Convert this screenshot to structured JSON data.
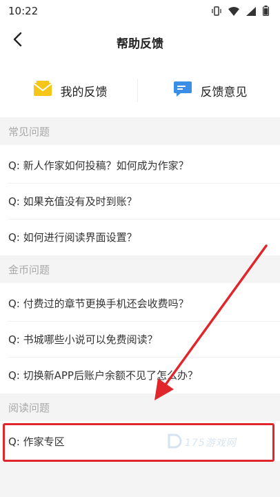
{
  "status_bar": {
    "time": "10:22"
  },
  "header": {
    "title": "帮助反馈"
  },
  "feedback": {
    "my_feedback_label": "我的反馈",
    "suggestion_label": "反馈意见"
  },
  "sections": [
    {
      "title": "常见问题",
      "questions": [
        "Q:  新人作家如何投稿？如何成为作家？",
        "Q:  如果充值没有及时到账？",
        "Q:  如何进行阅读界面设置？"
      ]
    },
    {
      "title": "金币问题",
      "questions": [
        "Q:  付费过的章节更换手机还会收费吗？",
        "Q:  书城哪些小说可以免费阅读？",
        "Q:  切换新APP后账户余额不见了怎么办？"
      ]
    },
    {
      "title": "阅读问题",
      "questions": [
        "Q:  作家专区"
      ]
    }
  ],
  "watermark": "175游戏网",
  "colors": {
    "highlight": "#e0262b",
    "section_bg": "#f4f4f4",
    "mail_icon": "#f5c518",
    "chat_icon": "#3a8ee6"
  }
}
